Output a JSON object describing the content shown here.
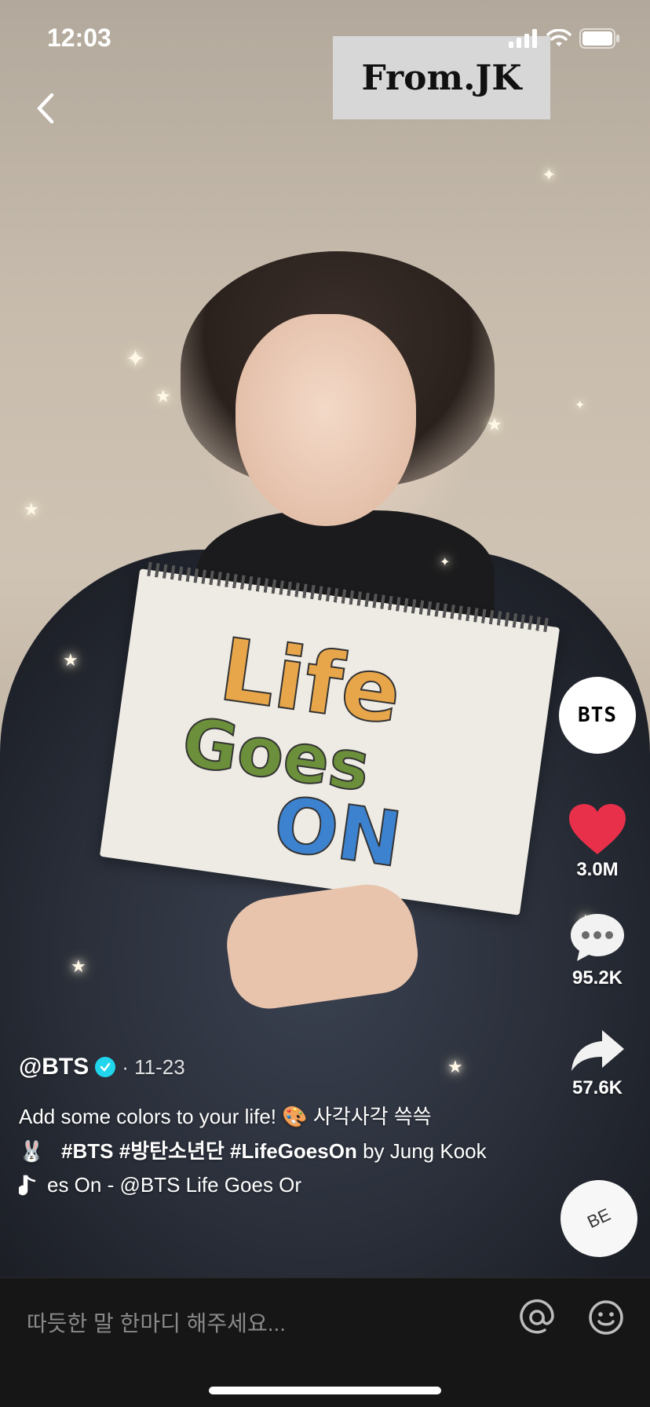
{
  "status_bar": {
    "time": "12:03"
  },
  "watermark": {
    "text": "From.JK"
  },
  "artwork": {
    "word1": "Life",
    "word2": "Goes",
    "word3": "ON"
  },
  "rail": {
    "avatar_label": "BTS",
    "likes": "3.0M",
    "comments": "95.2K",
    "shares": "57.6K",
    "disc_label": "BE"
  },
  "post": {
    "username": "@BTS",
    "date": "· 11-23",
    "caption_line1": "Add some colors to your life! 🎨 사각사각 쓱쓱",
    "caption_emoji": "🐰",
    "hashtags": "#BTS #방탄소년단 #LifeGoesOn",
    "by_text": "by Jung Kook",
    "music_text": "es On - @BTS    Life Goes Or"
  },
  "comment_bar": {
    "placeholder": "따듯한 말 한마디 해주세요..."
  },
  "colors": {
    "like": "#e8304a",
    "verified": "#20d5ec",
    "bar_bg": "#161616"
  },
  "icons": [
    "back-icon",
    "signal-icon",
    "wifi-icon",
    "battery-icon",
    "heart-icon",
    "comment-icon",
    "share-icon",
    "music-note-icon",
    "at-icon",
    "emoji-icon"
  ]
}
